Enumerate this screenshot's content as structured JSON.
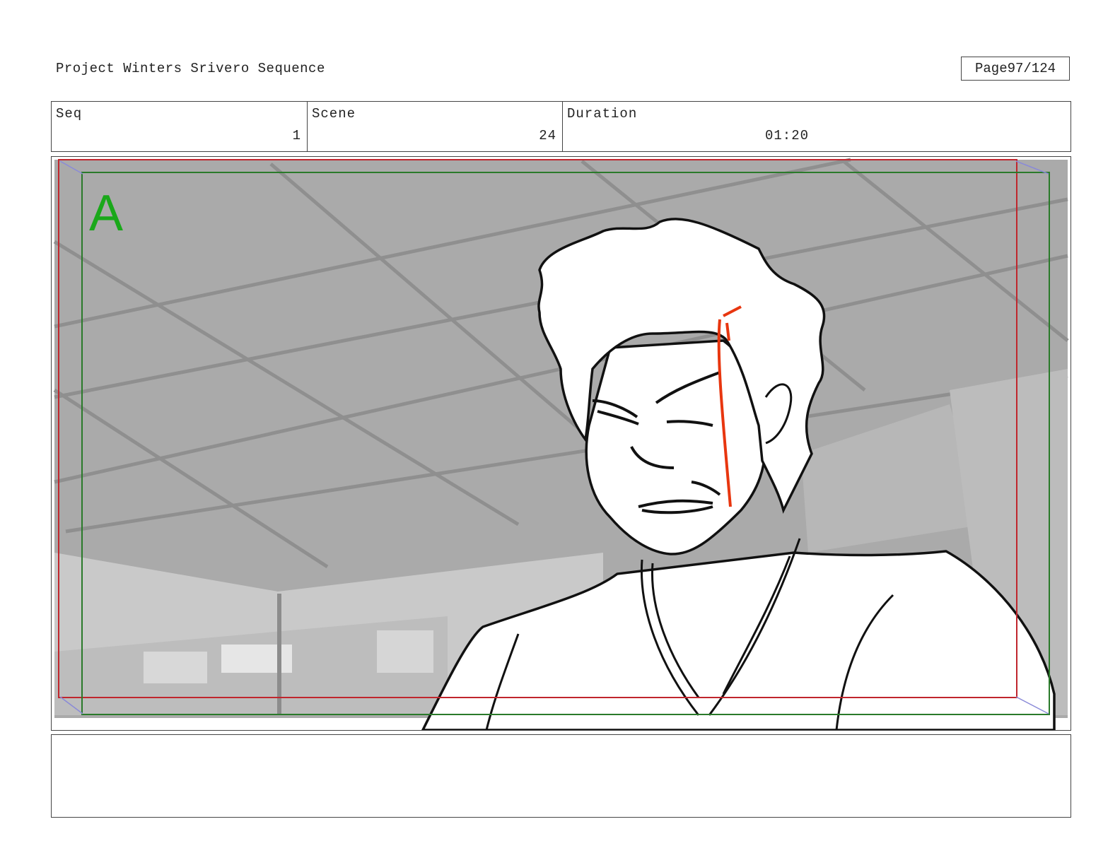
{
  "header": {
    "project_title": "Project Winters Srivero Sequence",
    "page_label": "Page",
    "page_number": "97/124"
  },
  "shot_info": {
    "seq_label": "Seq",
    "seq_value": "1",
    "scene_label": "Scene",
    "scene_value": "24",
    "duration_label": "Duration",
    "duration_value": "01:20"
  },
  "panel": {
    "panel_letter": "A",
    "description": "",
    "colors": {
      "action_safe": "#c0262d",
      "title_safe": "#2a7a2a",
      "panel_letter": "#1aa81a",
      "blood": "#e8360f",
      "background": "#a9a9a9"
    }
  },
  "notes": {
    "text": ""
  }
}
